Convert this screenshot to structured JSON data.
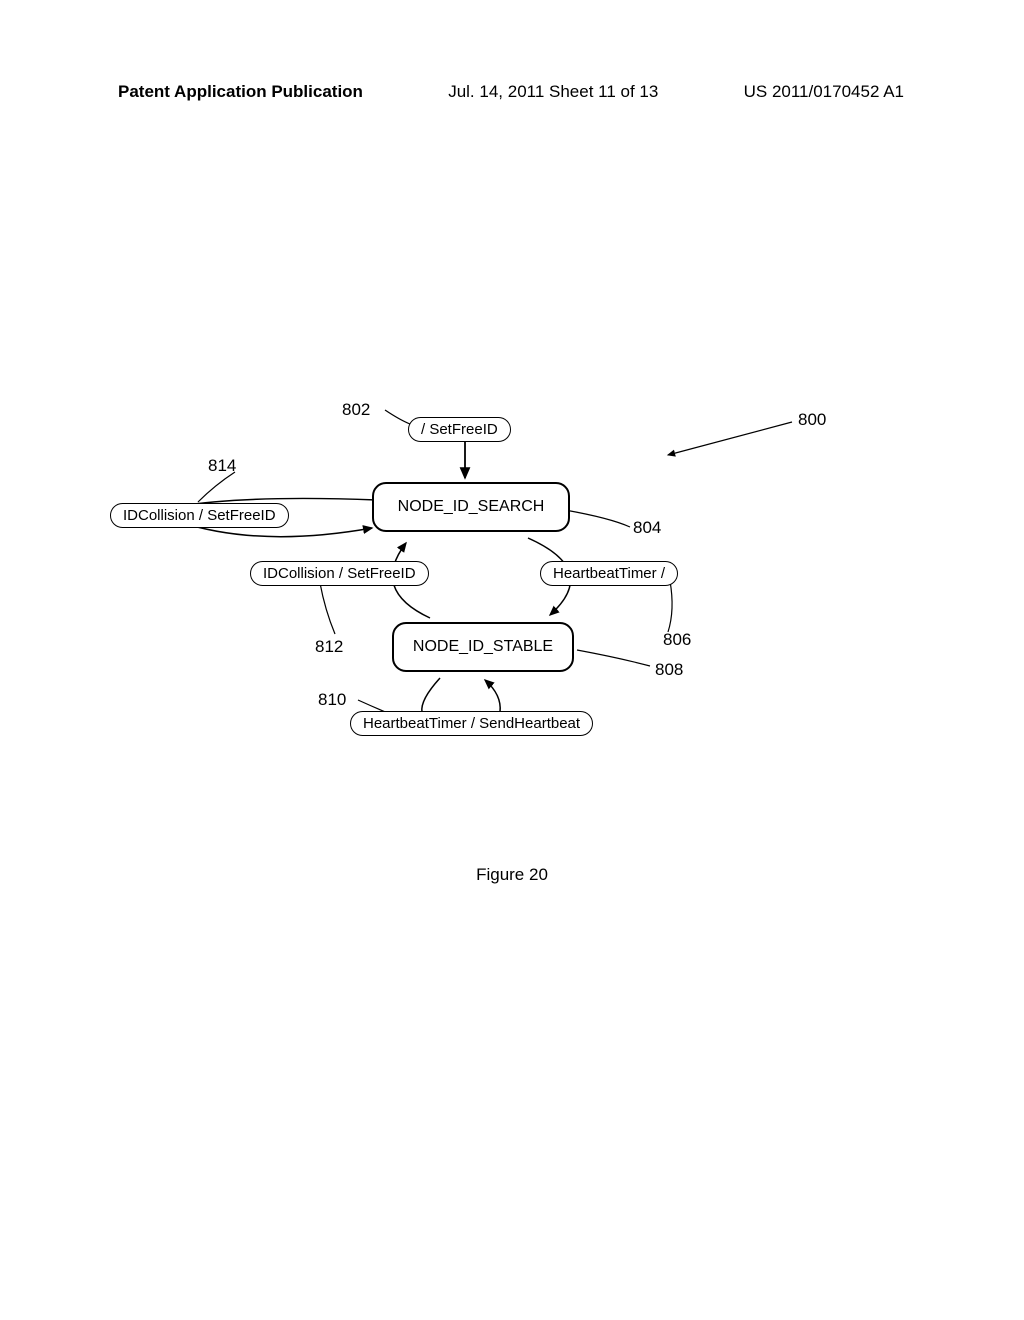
{
  "header": {
    "left": "Patent Application Publication",
    "center": "Jul. 14, 2011  Sheet 11 of 13",
    "right": "US 2011/0170452 A1"
  },
  "states": {
    "search": "NODE_ID_SEARCH",
    "stable": "NODE_ID_STABLE"
  },
  "transitions": {
    "init": "/ SetFreeID",
    "search_collision": "IDCollision / SetFreeID",
    "stable_to_search_collision": "IDCollision / SetFreeID",
    "heartbeat_to_stable": "HeartbeatTimer /",
    "stable_self_heartbeat": "HeartbeatTimer / SendHeartbeat"
  },
  "refs": {
    "r800": "800",
    "r802": "802",
    "r804": "804",
    "r806": "806",
    "r808": "808",
    "r810": "810",
    "r812": "812",
    "r814": "814"
  },
  "caption": "Figure 20"
}
